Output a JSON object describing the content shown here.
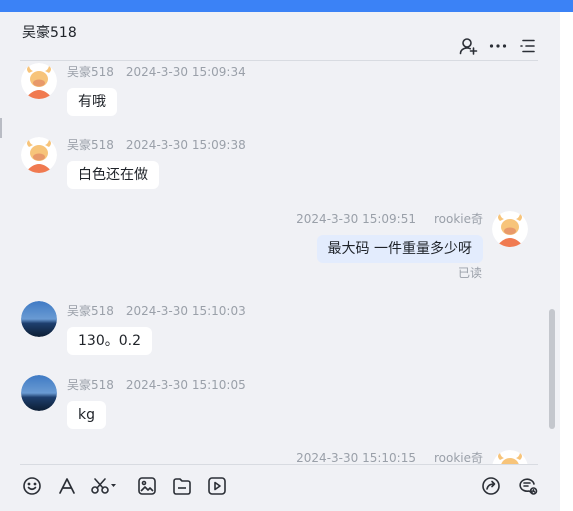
{
  "header": {
    "title": "吴豪518"
  },
  "messages": [
    {
      "sender": "吴豪518",
      "time": "2024-3-30 15:09:34",
      "text": "有哦"
    },
    {
      "sender": "吴豪518",
      "time": "2024-3-30 15:09:38",
      "text": "白色还在做"
    },
    {
      "sender": "rookie奇",
      "time": "2024-3-30 15:09:51",
      "text": "最大码 一件重量多少呀",
      "status": "已读"
    },
    {
      "sender": "吴豪518",
      "time": "2024-3-30 15:10:03",
      "text": "130。0.2"
    },
    {
      "sender": "吴豪518",
      "time": "2024-3-30 15:10:05",
      "text": "kg"
    },
    {
      "sender": "rookie奇",
      "time": "2024-3-30 15:10:15"
    }
  ],
  "colors": {
    "accent": "#3b82f6",
    "my_bubble": "#e3ecfd",
    "background": "#f0f1f5"
  },
  "icons": {
    "header": [
      "add-contact-icon",
      "more-icon",
      "menu-list-icon"
    ],
    "toolbar": [
      "emoji-icon",
      "font-icon",
      "scissors-icon",
      "image-icon",
      "folder-icon",
      "video-icon",
      "share-icon",
      "chat-history-icon"
    ]
  }
}
